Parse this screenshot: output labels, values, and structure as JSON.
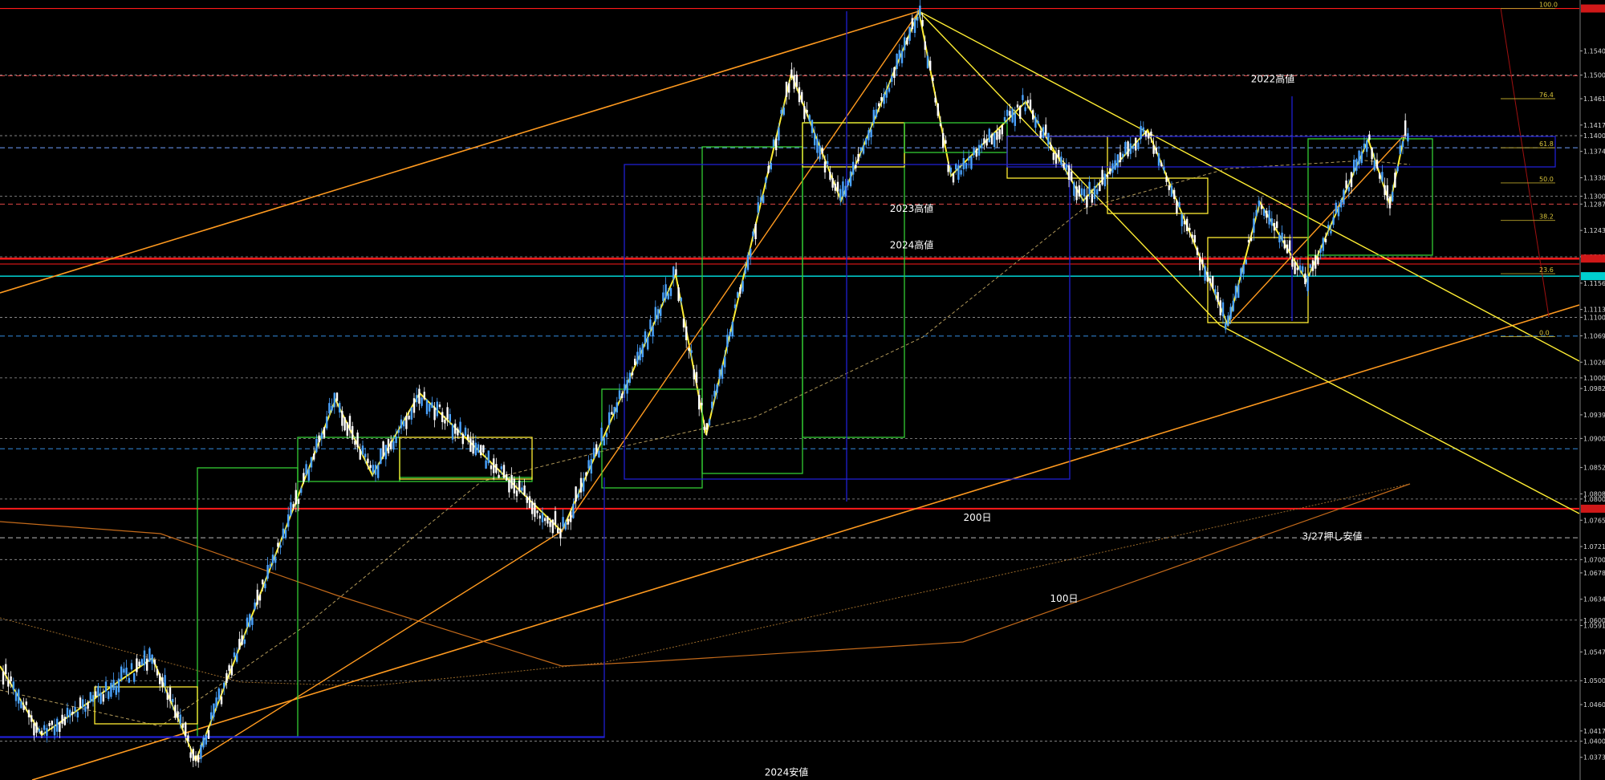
{
  "chart_data": {
    "type": "candlestick",
    "title": "",
    "xlabel": "",
    "ylabel": "",
    "ylim": [
      1.0336,
      1.1624
    ],
    "grid": false,
    "colors": {
      "bull": "#4aa3ff",
      "bear": "#ffffff",
      "zigzag": "#ffee33",
      "channel": "#ff9a1f",
      "resistance": "#ff1a1a",
      "support_cyan": "#00ffff",
      "box_green": "#33cc33",
      "box_blue": "#2020d0",
      "box_yellow": "#ffee33"
    },
    "price_ticks": [
      {
        "label": "1.15400",
        "value": 1.154
      },
      {
        "label": "1.15000",
        "value": 1.15
      },
      {
        "label": "1.14610",
        "value": 1.1461
      },
      {
        "label": "1.14175",
        "value": 1.14175
      },
      {
        "label": "1.14000",
        "value": 1.14
      },
      {
        "label": "1.13740",
        "value": 1.1374
      },
      {
        "label": "1.13305",
        "value": 1.13305
      },
      {
        "label": "1.13000",
        "value": 1.13
      },
      {
        "label": "1.12870",
        "value": 1.1287
      },
      {
        "label": "1.12435",
        "value": 1.12435
      },
      {
        "label": "1.12000",
        "value": 1.12
      },
      {
        "label": "1.11565",
        "value": 1.11565
      },
      {
        "label": "1.11130",
        "value": 1.1113
      },
      {
        "label": "1.11000",
        "value": 1.11
      },
      {
        "label": "1.10695",
        "value": 1.10695
      },
      {
        "label": "1.10260",
        "value": 1.1026
      },
      {
        "label": "1.10000",
        "value": 1.1
      },
      {
        "label": "1.09825",
        "value": 1.09825
      },
      {
        "label": "1.09390",
        "value": 1.0939
      },
      {
        "label": "1.09000",
        "value": 1.09
      },
      {
        "label": "1.08520",
        "value": 1.0852
      },
      {
        "label": "1.08085",
        "value": 1.08085
      },
      {
        "label": "1.08000",
        "value": 1.08
      },
      {
        "label": "1.07650",
        "value": 1.0765
      },
      {
        "label": "1.07215",
        "value": 1.07215
      },
      {
        "label": "1.07000",
        "value": 1.07
      },
      {
        "label": "1.06780",
        "value": 1.0678
      },
      {
        "label": "1.06345",
        "value": 1.06345
      },
      {
        "label": "1.06000",
        "value": 1.06
      },
      {
        "label": "1.05910",
        "value": 1.0591
      },
      {
        "label": "1.05475",
        "value": 1.05475
      },
      {
        "label": "1.05000",
        "value": 1.05
      },
      {
        "label": "1.04605",
        "value": 1.04605
      },
      {
        "label": "1.04170",
        "value": 1.0417
      },
      {
        "label": "1.04000",
        "value": 1.04
      },
      {
        "label": "1.03735",
        "value": 1.03735
      }
    ],
    "annotations": [
      {
        "text": "2022高値",
        "value": 1.1488,
        "xfrac": 0.793
      },
      {
        "text": "2023高値",
        "value": 1.1274,
        "xfrac": 0.568
      },
      {
        "text": "2024高値",
        "value": 1.1214,
        "xfrac": 0.568
      },
      {
        "text": "200日",
        "value": 1.0764,
        "xfrac": 0.609
      },
      {
        "text": "3/27押し安値",
        "value": 1.0733,
        "xfrac": 0.83
      },
      {
        "text": "100日",
        "value": 1.063,
        "xfrac": 0.663
      },
      {
        "text": "2024安値",
        "value": 1.0343,
        "xfrac": 0.49
      }
    ],
    "fibonacci": [
      {
        "label": "100.0",
        "value": 1.161
      },
      {
        "label": "76.4",
        "value": 1.1461
      },
      {
        "label": "61.8",
        "value": 1.138
      },
      {
        "label": "50.0",
        "value": 1.1322
      },
      {
        "label": "38.2",
        "value": 1.126
      },
      {
        "label": "23.6",
        "value": 1.1172
      },
      {
        "label": "0.0",
        "value": 1.1068
      }
    ]
  }
}
